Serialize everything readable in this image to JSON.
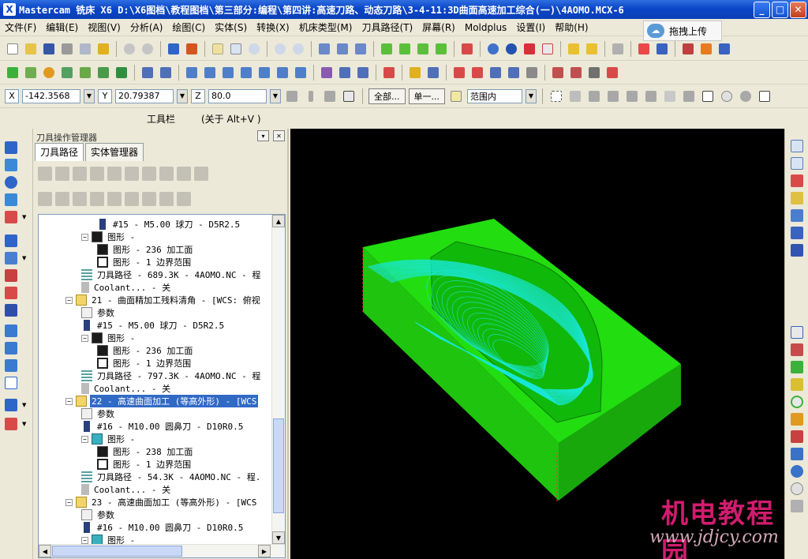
{
  "window": {
    "app_icon": "X",
    "title": "Mastercam 铣床 X6  D:\\X6图档\\教程图档\\第三部分:编程\\第四讲:高速刀路、动态刀路\\3-4-11:3D曲面高速加工综合(一)\\4AOMO.MCX-6",
    "min_label": "_",
    "max_label": "□",
    "close_label": "✕"
  },
  "menu": [
    "文件(F)",
    "编辑(E)",
    "视图(V)",
    "分析(A)",
    "绘图(C)",
    "实体(S)",
    "转换(X)",
    "机床类型(M)",
    "刀具路径(T)",
    "屏幕(R)",
    "Moldplus",
    "设置(I)",
    "帮助(H)"
  ],
  "upload_button": {
    "label": "拖拽上传",
    "icon": "cloud-icon"
  },
  "coords": {
    "x_label": "X",
    "x_value": "-142.3568",
    "y_label": "Y",
    "y_value": "20.79387",
    "z_label": "Z",
    "z_value": "80.0",
    "all_button": "全部...",
    "single_button": "单一...",
    "range_select": "范围内"
  },
  "toolbar_label": {
    "name": "工具栏",
    "hint": "(关于 Alt+V )"
  },
  "panel": {
    "title": "刀具操作管理器",
    "tabs": [
      "刀具路径",
      "实体管理器"
    ],
    "pin_label": "▾",
    "close_label": "✕"
  },
  "tree": [
    {
      "level": 3,
      "icon": "tool",
      "text": "#15 - M5.00 球刀 - D5R2.5"
    },
    {
      "level": 2,
      "icon": "geo",
      "text": "图形 -",
      "expander": "−"
    },
    {
      "level": 3,
      "icon": "geo",
      "text": "图形 - 236 加工面"
    },
    {
      "level": 3,
      "icon": "geo2",
      "text": "图形 - 1 边界范围"
    },
    {
      "level": 2,
      "icon": "path",
      "text": "刀具路径 - 689.3K - 4AOMO.NC - 程"
    },
    {
      "level": 2,
      "icon": "cool",
      "text": "Coolant... - 关"
    },
    {
      "level": 1,
      "icon": "folder",
      "text": "21 - 曲面精加工残料清角 - [WCS: 俯视",
      "expander": "−"
    },
    {
      "level": 2,
      "icon": "param",
      "text": "参数"
    },
    {
      "level": 2,
      "icon": "tool",
      "text": "#15 - M5.00 球刀 - D5R2.5"
    },
    {
      "level": 2,
      "icon": "geo",
      "text": "图形 -",
      "expander": "−"
    },
    {
      "level": 3,
      "icon": "geo",
      "text": "图形 - 236 加工面"
    },
    {
      "level": 3,
      "icon": "geo2",
      "text": "图形 - 1 边界范围"
    },
    {
      "level": 2,
      "icon": "path",
      "text": "刀具路径 - 797.3K - 4AOMO.NC - 程"
    },
    {
      "level": 2,
      "icon": "cool",
      "text": "Coolant... - 关"
    },
    {
      "level": 1,
      "icon": "folder",
      "text": "22 - 高速曲面加工 (等高外形) - [WCS",
      "expander": "−",
      "selected": true
    },
    {
      "level": 2,
      "icon": "param",
      "text": "参数"
    },
    {
      "level": 2,
      "icon": "tool",
      "text": "#16 - M10.00 圆鼻刀 - D10R0.5"
    },
    {
      "level": 2,
      "icon": "geofolder",
      "text": "图形 -",
      "expander": "−"
    },
    {
      "level": 3,
      "icon": "geo",
      "text": "图形 - 238 加工面"
    },
    {
      "level": 3,
      "icon": "geo2",
      "text": "图形 - 1 边界范围"
    },
    {
      "level": 2,
      "icon": "path",
      "text": "刀具路径 - 54.3K - 4AOMO.NC - 程."
    },
    {
      "level": 2,
      "icon": "cool",
      "text": "Coolant... - 关"
    },
    {
      "level": 1,
      "icon": "folder",
      "text": "23 - 高速曲面加工 (等高外形) - [WCS",
      "expander": "−"
    },
    {
      "level": 2,
      "icon": "param",
      "text": "参数"
    },
    {
      "level": 2,
      "icon": "tool",
      "text": "#16 - M10.00 圆鼻刀 - D10R0.5"
    },
    {
      "level": 2,
      "icon": "geofolder",
      "text": "图形 -",
      "expander": "−"
    }
  ],
  "scroll": {
    "up": "▲",
    "down": "▼",
    "left": "◀",
    "right": "▶"
  },
  "viewport": {
    "watermark": "机电教程园",
    "watermark_url": "www.jdjcy.com",
    "part_color": "#22dd10",
    "toolpath_color": "#19e8d8"
  },
  "icons": {
    "toolbar1": [
      "new-file-icon",
      "open-file-icon",
      "save-icon",
      "print-icon",
      "print-preview-icon",
      "wand-icon",
      "undo-icon",
      "redo-icon",
      "move-icon",
      "shade-icon",
      "zoom-window-icon",
      "zoom-fit-icon",
      "zoom-out-icon",
      "unzoom-icon",
      "zoom-in-icon",
      "wireframe-icon",
      "shaded-icon",
      "tool-icon",
      "solid-cube-icon",
      "solid-cube-icon",
      "solid-cube-icon",
      "solid-cube-icon",
      "view-cube-icon",
      "globe-icon",
      "sphere-icon",
      "surface-icon",
      "eraser-icon",
      "pencil-icon",
      "star-icon",
      "magic-icon",
      "help-icon",
      "grid-icon",
      "plot-icon",
      "color-icon",
      "arrow-right-icon"
    ],
    "toolbar2": [
      "plus-icon",
      "line-icon",
      "circle-icon",
      "rect-icon",
      "fillet-icon",
      "chamfer-icon",
      "cylinder-icon",
      "trim-icon",
      "break-icon",
      "move-icon",
      "mirror-icon",
      "rotate-icon",
      "scale-icon",
      "array-icon",
      "offset-icon",
      "project-icon",
      "wrap-icon",
      "stretch-icon",
      "drag-icon",
      "move-icon",
      "copy-icon",
      "table-icon",
      "list-icon",
      "book-icon",
      "link-icon",
      "gear-icon",
      "graph-icon",
      "wire-icon"
    ]
  }
}
